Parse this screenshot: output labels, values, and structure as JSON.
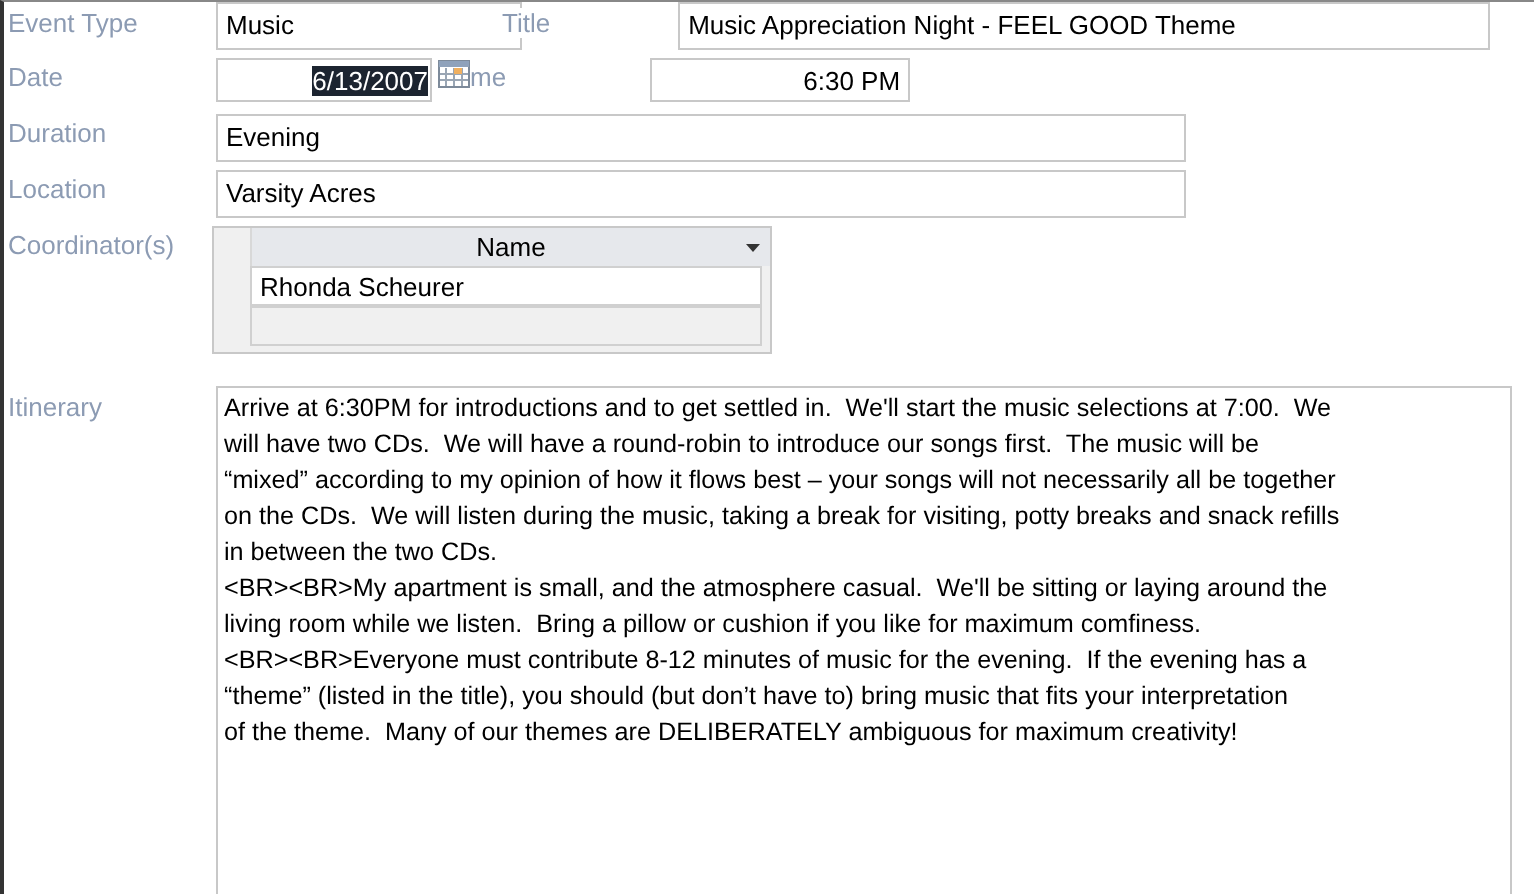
{
  "fields": [
    {
      "kind": "pair",
      "label": "Event Type",
      "value": "Music",
      "label2": "Title",
      "value2": "Music Appreciation Night - FEEL GOOD Theme"
    },
    {
      "kind": "date",
      "label": "Date",
      "value": "6/13/2007",
      "text_selected": true,
      "label2": "me",
      "value2": "6:30 PM"
    },
    {
      "kind": "text",
      "label": "Duration",
      "value": "Evening"
    },
    {
      "kind": "text",
      "label": "Location",
      "value": "Varsity Acres"
    }
  ],
  "coordinators": {
    "label": "Coordinator(s)",
    "column": "Name",
    "rows": [
      "Rhonda Scheurer"
    ]
  },
  "itinerary": {
    "label": "Itinerary",
    "lines": [
      "Arrive at 6:30PM for introductions and to get settled in.  We'll start the music selections at 7:00.  We",
      "will have two CDs.  We will have a round-robin to introduce our songs first.  The music will be",
      "“mixed” according to my opinion of how it flows best – your songs will not necessarily all be together",
      "on the CDs.  We will listen during the music, taking a break for visiting, potty breaks and snack refills",
      "in between the two CDs.",
      "<BR><BR>My apartment is small, and the atmosphere casual.  We'll be sitting or laying around the",
      "living room while we listen.  Bring a pillow or cushion if you like for maximum comfiness.",
      "<BR><BR>Everyone must contribute 8-12 minutes of music for the evening.  If the evening has a",
      "“theme” (listed in the title), you should (but don’t have to) bring music that fits your interpretation",
      "of the theme.  Many of our themes are DELIBERATELY ambiguous for maximum creativity!"
    ]
  }
}
